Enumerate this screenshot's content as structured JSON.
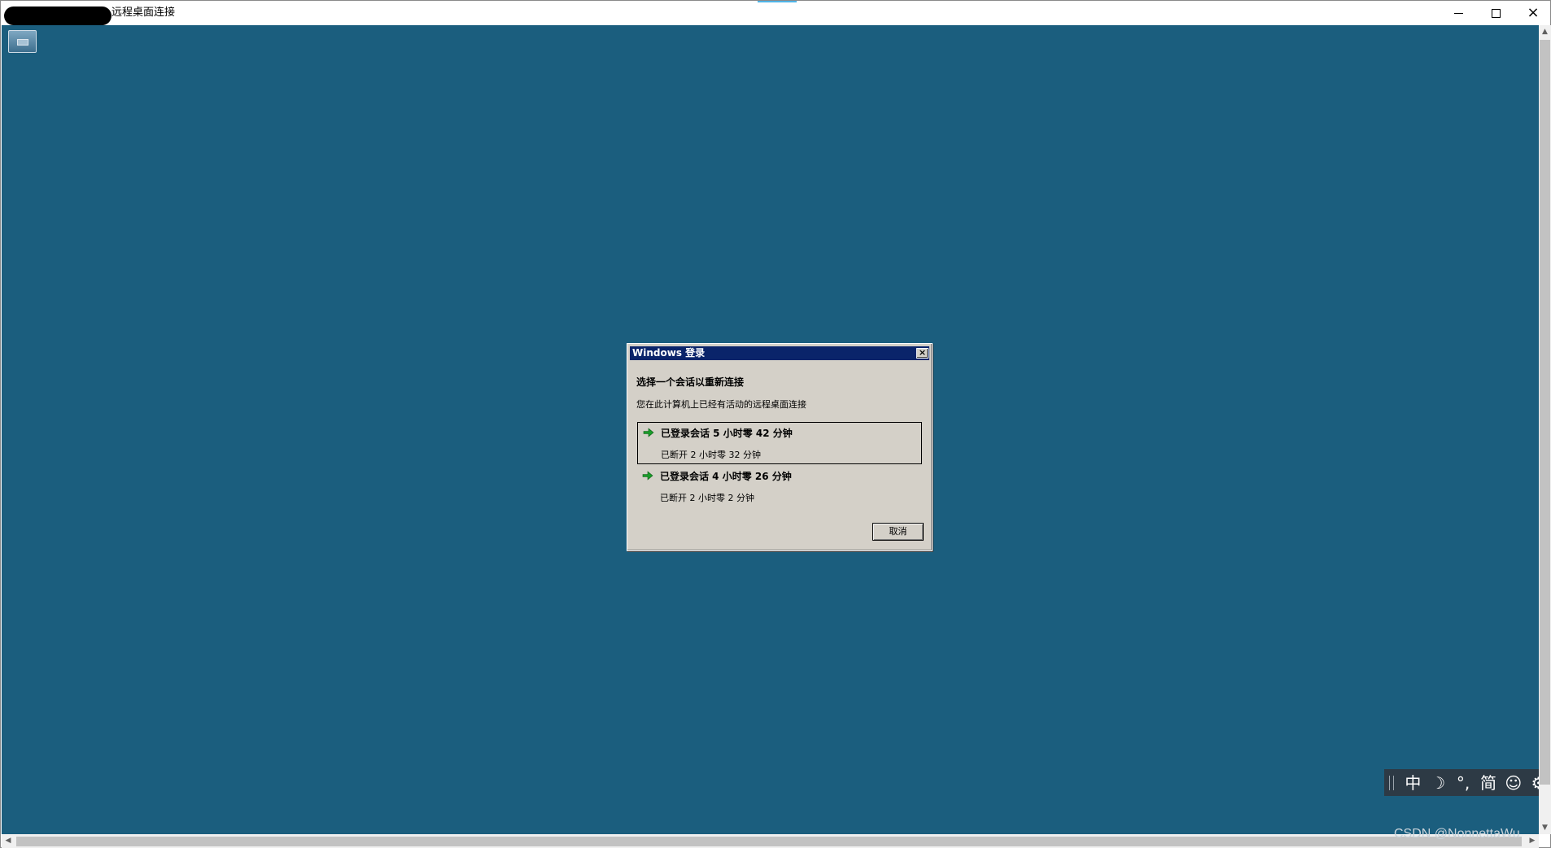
{
  "window": {
    "title": "远程桌面连接",
    "controls": {
      "minimize": "minimize",
      "maximize": "maximize",
      "close": "×"
    }
  },
  "dialog": {
    "title": "Windows 登录",
    "close_label": "×",
    "heading": "选择一个会话以重新连接",
    "description": "您在此计算机上已经有活动的远程桌面连接",
    "sessions": [
      {
        "title": "已登录会话 5 小时零 42 分钟",
        "status": "已断开 2 小时零 32 分钟",
        "selected": true
      },
      {
        "title": "已登录会话 4 小时零 26 分钟",
        "status": "已断开 2 小时零 2 分钟",
        "selected": false
      }
    ],
    "cancel_label": "取消"
  },
  "ime": {
    "items": [
      "中",
      "☽",
      "°,",
      "简",
      "☺",
      "⚙"
    ]
  },
  "watermark": "CSDN @NonnettaWu",
  "colors": {
    "desktop": "#1b5e7e",
    "dialog_titlebar": "#0a246a",
    "dialog_face": "#d4d0c8",
    "arrow_green": "#1a9c2a"
  },
  "icons": {
    "session_arrow": "green-right-arrow-icon",
    "connection_pin": "connection-bar-pin-icon"
  }
}
